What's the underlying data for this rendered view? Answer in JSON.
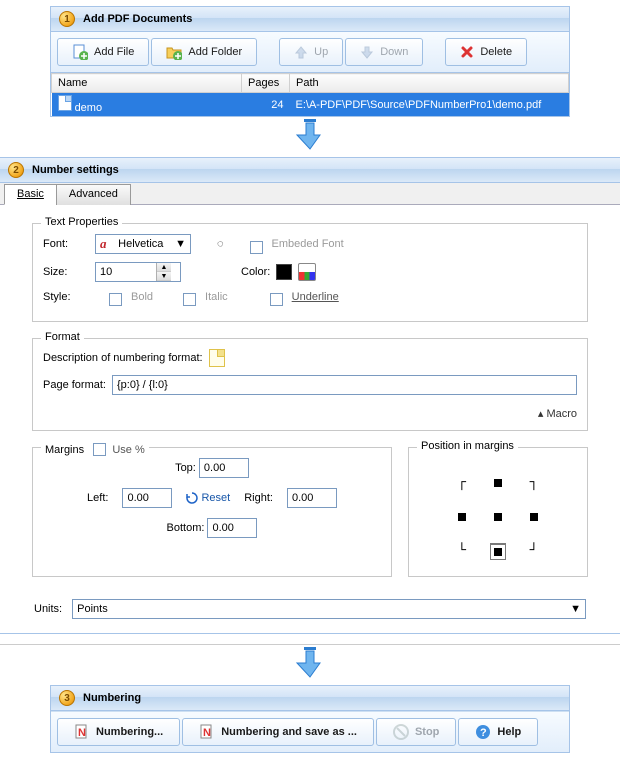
{
  "step1": {
    "title": "Add PDF Documents",
    "toolbar": {
      "add_file": "Add File",
      "add_folder": "Add Folder",
      "up": "Up",
      "down": "Down",
      "delete": "Delete"
    },
    "columns": {
      "name": "Name",
      "pages": "Pages",
      "path": "Path"
    },
    "rows": [
      {
        "name": "demo",
        "pages": "24",
        "path": "E:\\A-PDF\\PDF\\Source\\PDFNumberPro1\\demo.pdf"
      }
    ]
  },
  "step2": {
    "title": "Number settings",
    "tabs": {
      "basic": "Basic",
      "advanced": "Advanced"
    },
    "text_props": {
      "legend": "Text Properties",
      "font_label": "Font:",
      "font_value": "Helvetica",
      "embedded_label": "Embeded Font",
      "size_label": "Size:",
      "size_value": "10",
      "color_label": "Color:",
      "color_value": "#000000",
      "style_label": "Style:",
      "bold": "Bold",
      "italic": "Italic",
      "underline": "Underline"
    },
    "format": {
      "legend": "Format",
      "desc_label": "Description of numbering format:",
      "page_format_label": "Page format:",
      "page_format_value": "{p:0} / {l:0}",
      "macro_label": "Macro"
    },
    "margins": {
      "legend": "Margins",
      "use_percent": "Use %",
      "top": "Top:",
      "left": "Left:",
      "right": "Right:",
      "bottom": "Bottom:",
      "reset": "Reset",
      "top_v": "0.00",
      "left_v": "0.00",
      "right_v": "0.00",
      "bottom_v": "0.00"
    },
    "position": {
      "legend": "Position in margins",
      "selected": "bottom-center"
    },
    "units": {
      "label": "Units:",
      "value": "Points"
    }
  },
  "step3": {
    "title": "Numbering",
    "btn_numbering": "Numbering...",
    "btn_save_as": "Numbering and save as ...",
    "btn_stop": "Stop",
    "btn_help": "Help"
  }
}
